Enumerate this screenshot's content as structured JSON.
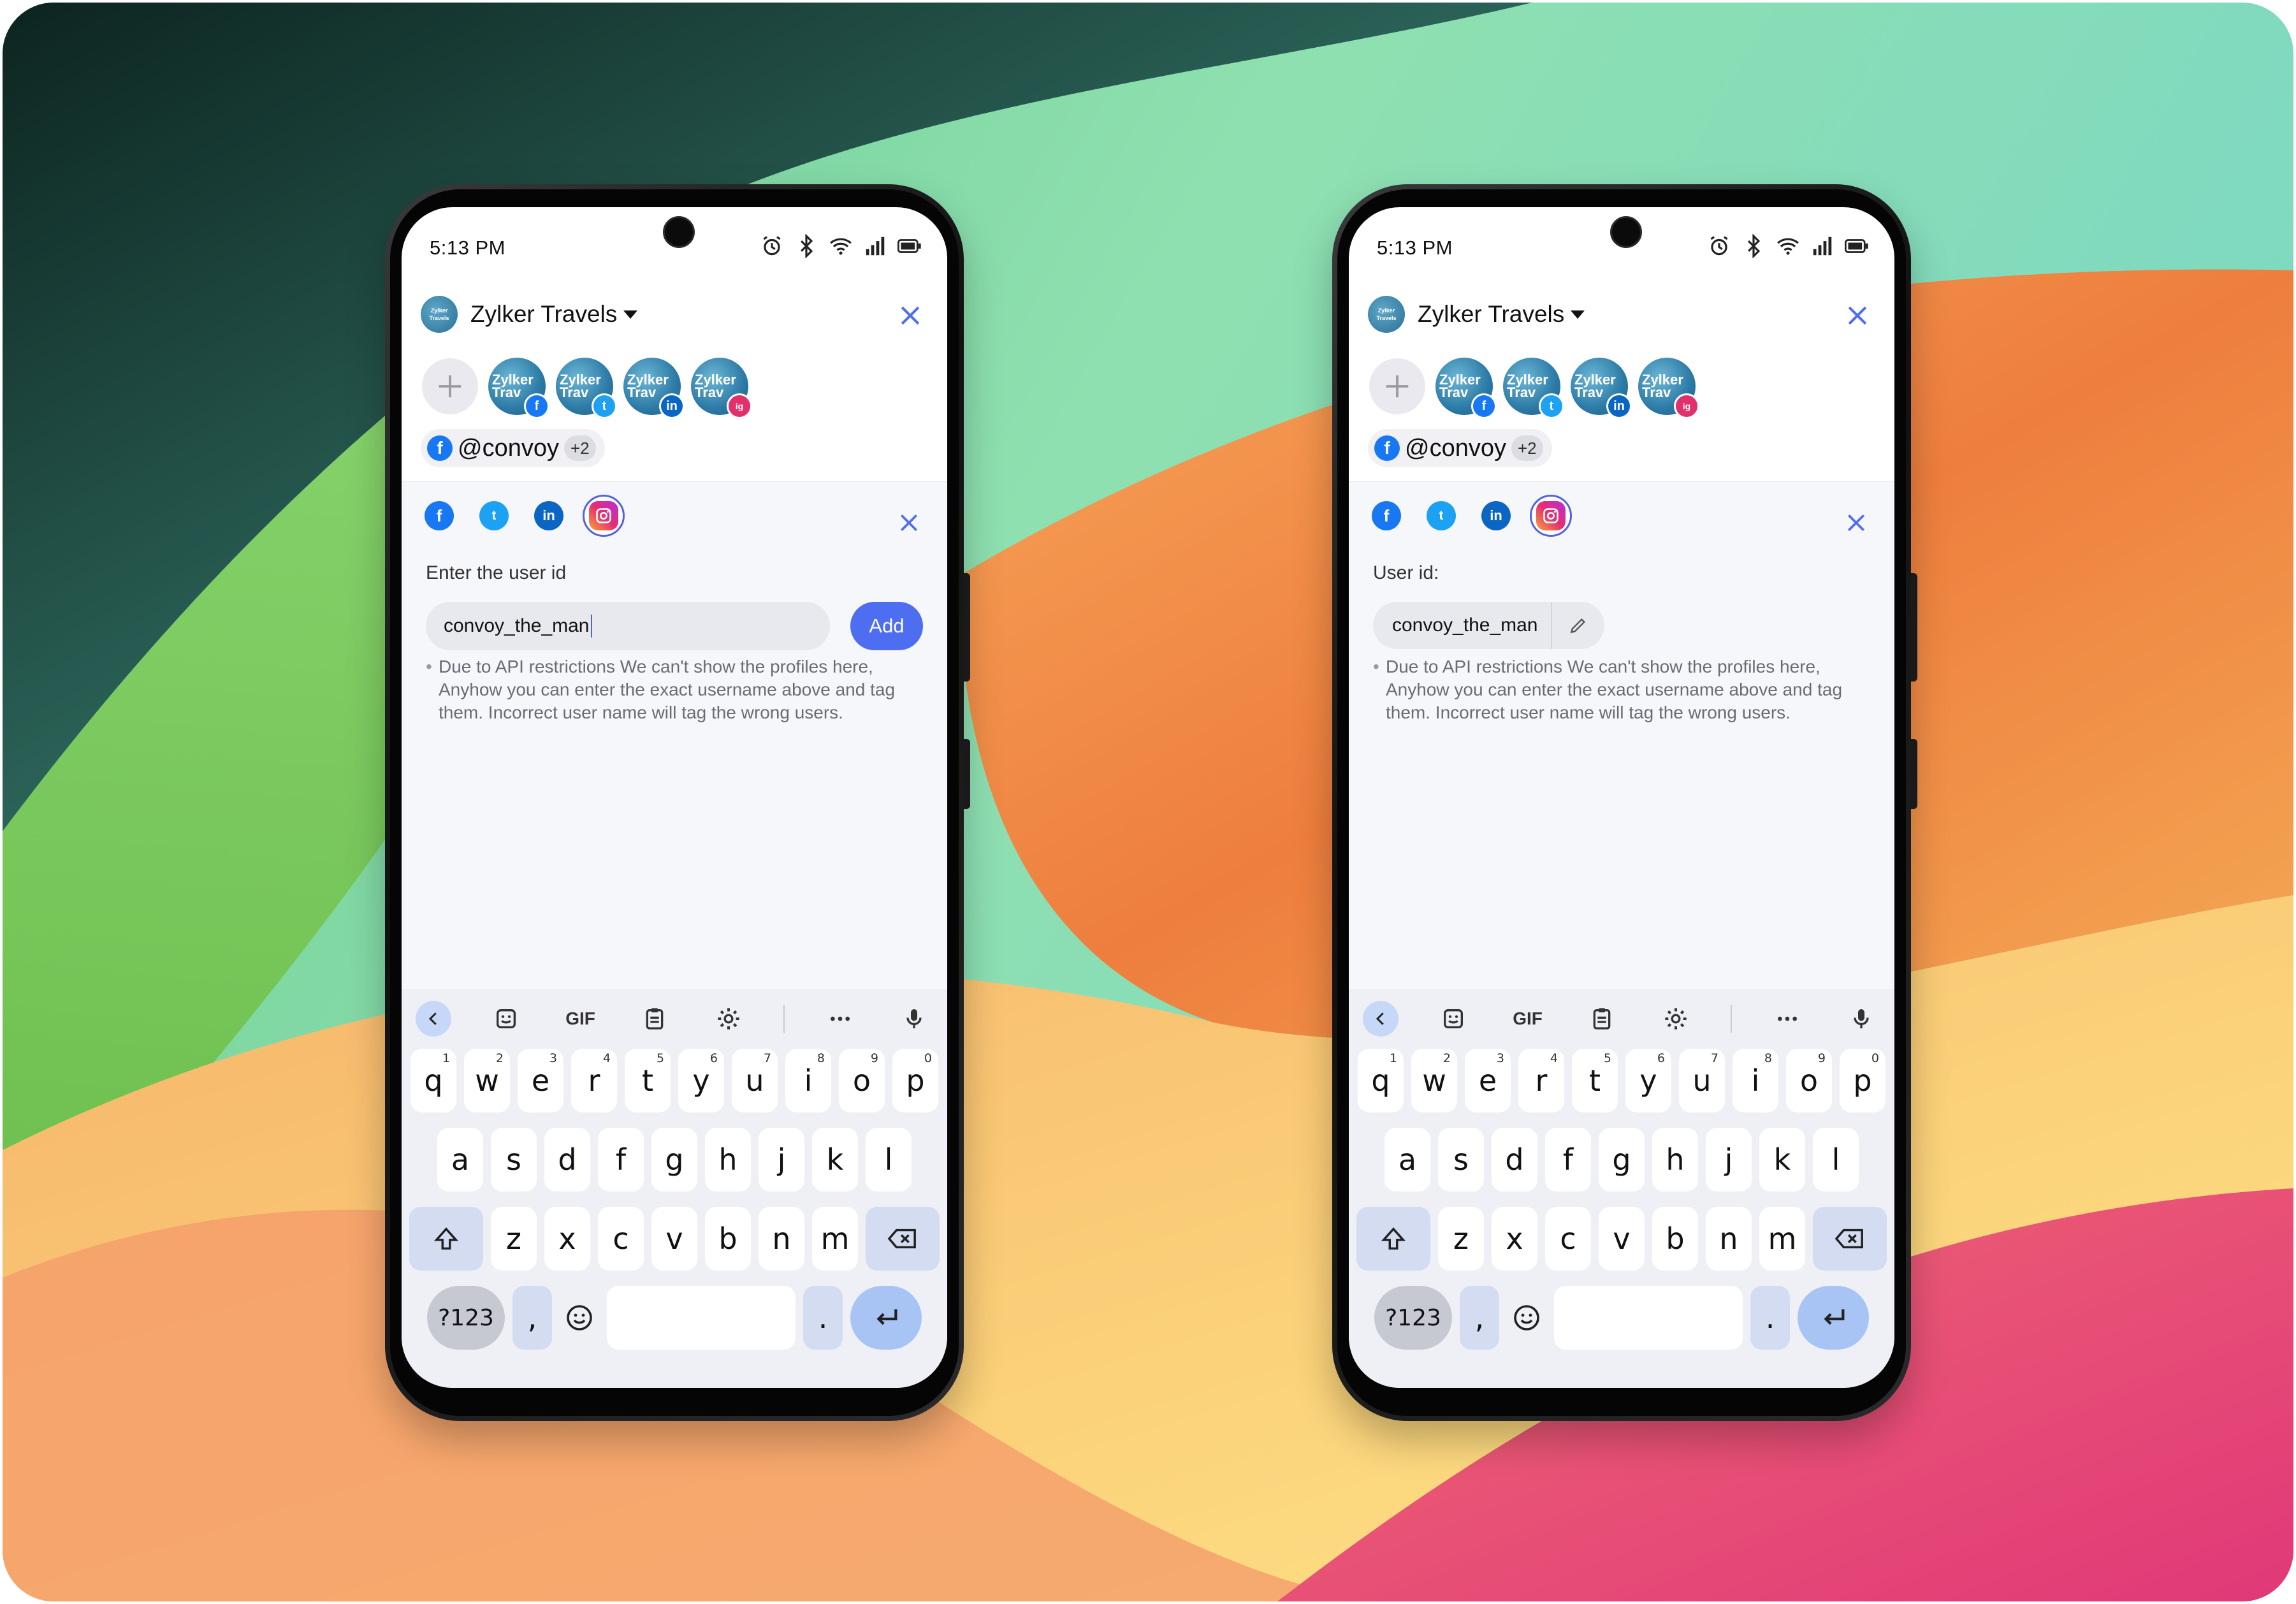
{
  "status": {
    "time": "5:13 PM"
  },
  "account": {
    "name": "Zylker Travels",
    "logo_text": "Zylker Travels"
  },
  "avatars": [
    {
      "network": "facebook",
      "text": "Zylker Trav",
      "badge": "f",
      "color": "#1877f2"
    },
    {
      "network": "twitter",
      "text": "Zylker Trav",
      "badge": "t",
      "color": "#1da1f2"
    },
    {
      "network": "linkedin",
      "text": "Zylker Trav",
      "badge": "in",
      "color": "#0a66c2"
    },
    {
      "network": "instagram",
      "text": "Zylker Trav",
      "badge": "ig",
      "color": "#e1306c"
    }
  ],
  "tag": {
    "name": "@convoy",
    "more": "+2"
  },
  "left": {
    "label": "Enter the user id",
    "input_value": "convoy_the_man",
    "add_label": "Add"
  },
  "right": {
    "label": "User id:",
    "user_id": "convoy_the_man"
  },
  "note": "Due to API restrictions We can't show the profiles here, Anyhow you can enter the exact username above and tag them. Incorrect user name will tag the wrong users.",
  "keyboard": {
    "toolbar": {
      "gif": "GIF"
    },
    "row1": [
      [
        "q",
        "1"
      ],
      [
        "w",
        "2"
      ],
      [
        "e",
        "3"
      ],
      [
        "r",
        "4"
      ],
      [
        "t",
        "5"
      ],
      [
        "y",
        "6"
      ],
      [
        "u",
        "7"
      ],
      [
        "i",
        "8"
      ],
      [
        "o",
        "9"
      ],
      [
        "p",
        "0"
      ]
    ],
    "row2": [
      "a",
      "s",
      "d",
      "f",
      "g",
      "h",
      "j",
      "k",
      "l"
    ],
    "row3": [
      "z",
      "x",
      "c",
      "v",
      "b",
      "n",
      "m"
    ],
    "num_label": "?123",
    "comma": ",",
    "period": "."
  },
  "colors": {
    "accent": "#4e6ef2",
    "facebook": "#1877f2",
    "twitter": "#1da1f2",
    "linkedin": "#0a66c2",
    "instagram": "#e1306c"
  },
  "icons": [
    "alarm-icon",
    "bluetooth-icon",
    "wifi-icon",
    "signal-icon",
    "battery-icon",
    "close-icon",
    "plus-icon",
    "pencil-icon",
    "sticker-icon",
    "clipboard-icon",
    "gear-icon",
    "more-icon",
    "mic-icon",
    "shift-icon",
    "backspace-icon",
    "emoji-icon",
    "enter-icon"
  ]
}
